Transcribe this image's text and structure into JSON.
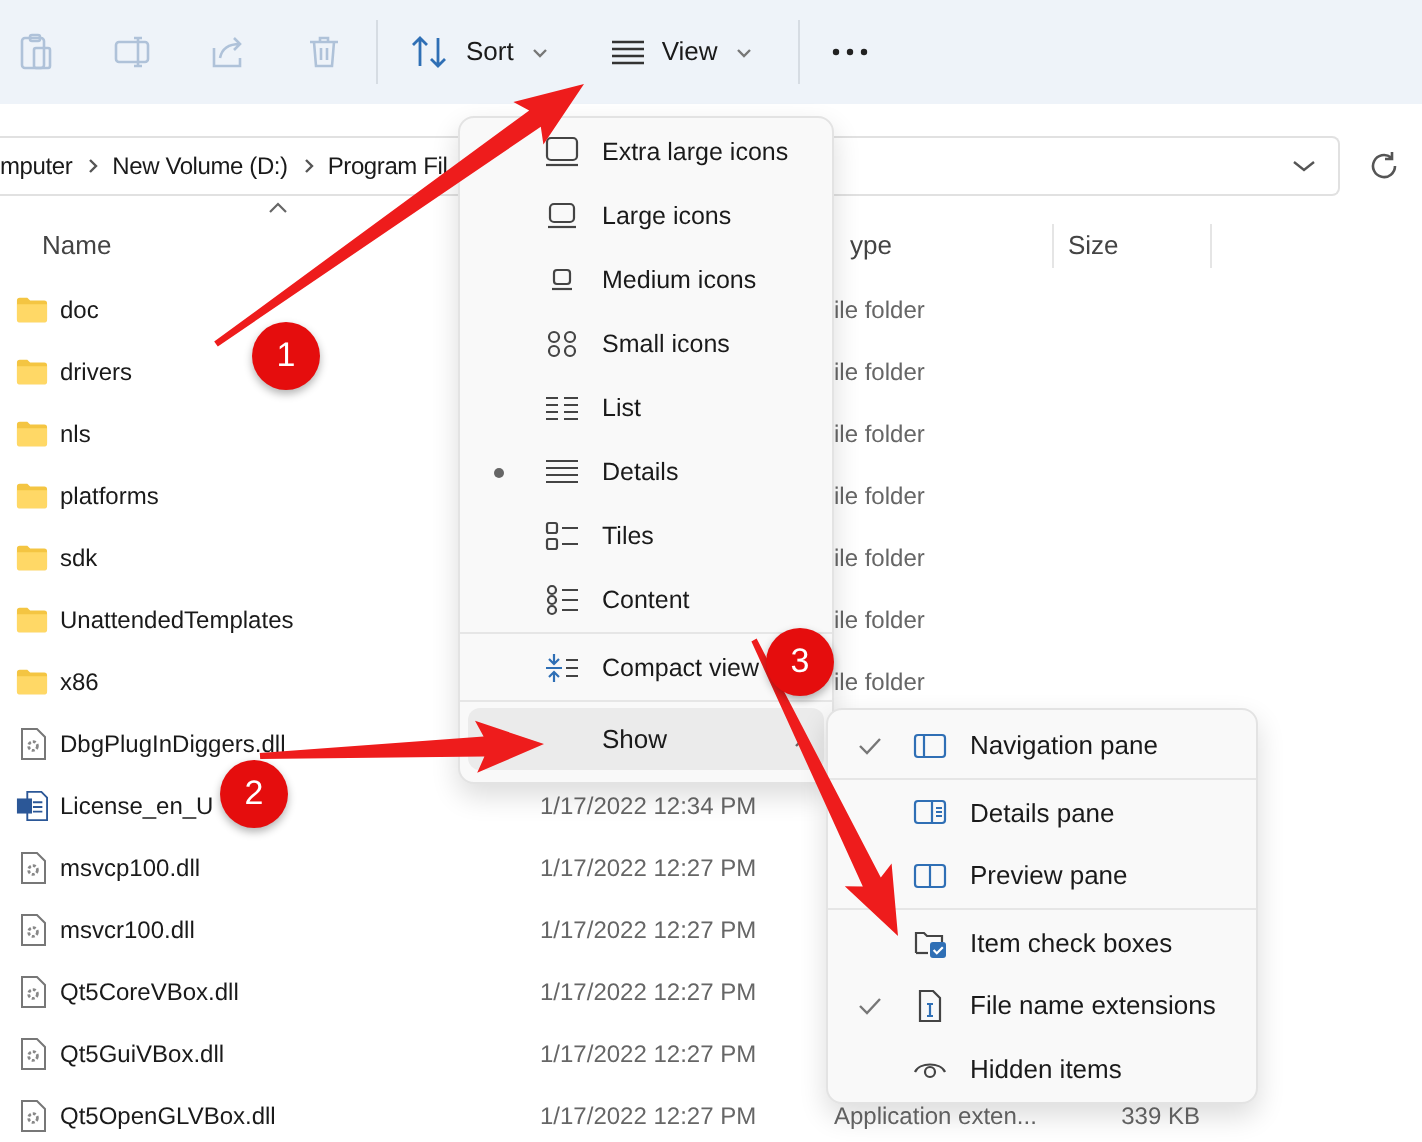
{
  "toolbar": {
    "icon_buttons": [
      {
        "kind": "paste",
        "disabled": true
      },
      {
        "kind": "rename",
        "disabled": true
      },
      {
        "kind": "share",
        "disabled": true
      },
      {
        "kind": "delete",
        "disabled": true
      }
    ],
    "menu_buttons": [
      {
        "kind": "sort",
        "label": "Sort"
      },
      {
        "kind": "view",
        "label": "View"
      }
    ]
  },
  "address_bar": {
    "crumbs": [
      "mputer",
      "New Volume (D:)",
      "Program Fil"
    ]
  },
  "columns": [
    {
      "label": "Name"
    },
    {
      "label": "ype"
    },
    {
      "label": "Size"
    }
  ],
  "rows": [
    {
      "kind": "folder",
      "name": "doc",
      "type": "ile folder"
    },
    {
      "kind": "folder",
      "name": "drivers",
      "type": "ile folder"
    },
    {
      "kind": "folder",
      "name": "nls",
      "type": "ile folder"
    },
    {
      "kind": "folder",
      "name": "platforms",
      "type": "ile folder"
    },
    {
      "kind": "folder",
      "name": "sdk",
      "type": "ile folder"
    },
    {
      "kind": "folder",
      "name": "UnattendedTemplates",
      "type": "ile folder"
    },
    {
      "kind": "folder",
      "name": "x86",
      "type": "ile folder"
    },
    {
      "kind": "dll",
      "name": "DbgPlugInDiggers.dll"
    },
    {
      "kind": "document",
      "name": "License_en_U",
      "date": "1/17/2022 12:34 PM"
    },
    {
      "kind": "dll",
      "name": "msvcp100.dll",
      "date": "1/17/2022 12:27 PM"
    },
    {
      "kind": "dll",
      "name": "msvcr100.dll",
      "date": "1/17/2022 12:27 PM"
    },
    {
      "kind": "dll",
      "name": "Qt5CoreVBox.dll",
      "date": "1/17/2022 12:27 PM"
    },
    {
      "kind": "dll",
      "name": "Qt5GuiVBox.dll",
      "date": "1/17/2022 12:27 PM"
    },
    {
      "kind": "dll",
      "name": "Qt5OpenGLVBox.dll",
      "date": "1/17/2022 12:27 PM",
      "type": "Application exten...",
      "size": "339 KB"
    }
  ],
  "view_menu": {
    "groups": [
      {
        "items": [
          {
            "kind": "xl",
            "label": "Extra large icons",
            "selected": false
          },
          {
            "kind": "large",
            "label": "Large icons",
            "selected": false
          },
          {
            "kind": "medium",
            "label": "Medium icons",
            "selected": false
          },
          {
            "kind": "small",
            "label": "Small icons",
            "selected": false
          },
          {
            "kind": "list",
            "label": "List",
            "selected": false
          },
          {
            "kind": "details",
            "label": "Details",
            "selected": true
          },
          {
            "kind": "tiles",
            "label": "Tiles",
            "selected": false
          },
          {
            "kind": "content",
            "label": "Content",
            "selected": false
          }
        ]
      },
      {
        "items": [
          {
            "kind": "compact",
            "label": "Compact view",
            "selected": false
          }
        ]
      },
      {
        "items": [
          {
            "kind": "submenu",
            "label": "Show",
            "highlighted": true
          }
        ]
      }
    ]
  },
  "show_menu": {
    "groups": [
      {
        "items": [
          {
            "kind": "navigation",
            "label": "Navigation pane",
            "checked": true
          }
        ]
      },
      {
        "items": [
          {
            "kind": "details_pane",
            "label": "Details pane",
            "checked": false
          },
          {
            "kind": "preview",
            "label": "Preview pane",
            "checked": false
          }
        ]
      },
      {
        "items": [
          {
            "kind": "checkboxes",
            "label": "Item check boxes",
            "checked": false
          },
          {
            "kind": "extensions",
            "label": "File name extensions",
            "checked": true
          },
          {
            "kind": "hidden",
            "label": "Hidden items",
            "checked": false
          }
        ]
      }
    ]
  },
  "annotations": [
    {
      "label": "1"
    },
    {
      "label": "2"
    },
    {
      "label": "3"
    }
  ]
}
